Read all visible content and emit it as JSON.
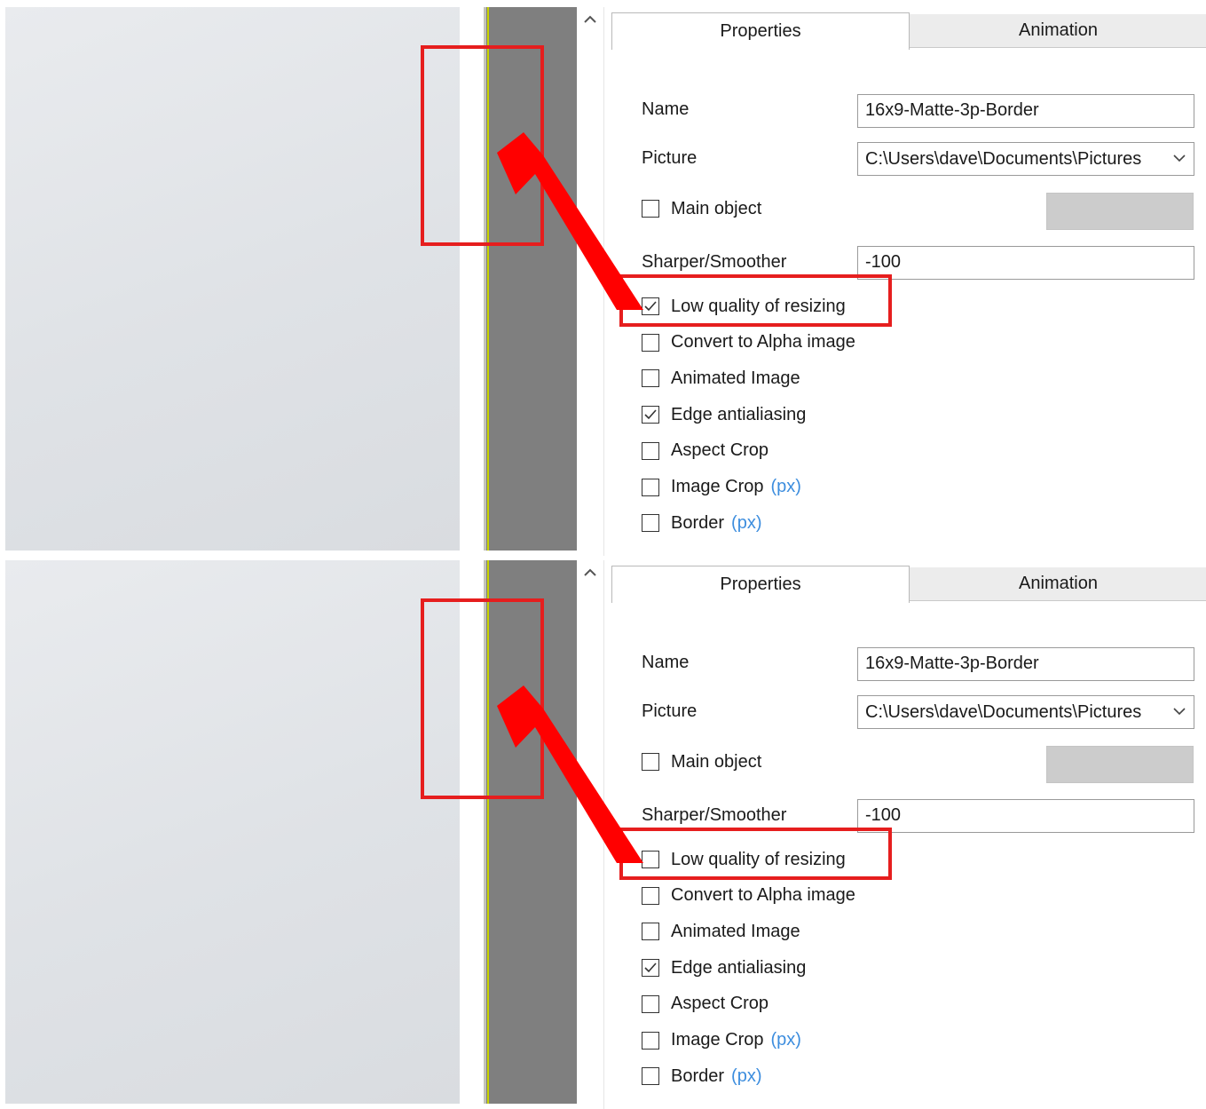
{
  "panels": [
    {
      "tabs": {
        "properties": "Properties",
        "animation": "Animation"
      },
      "name_label": "Name",
      "name_value": "16x9-Matte-3p-Border",
      "picture_label": "Picture",
      "picture_value": "C:\\Users\\dave\\Documents\\Pictures",
      "main_object_label": "Main object",
      "sharper_label": "Sharper/Smoother",
      "sharper_value": "-100",
      "checkboxes": [
        {
          "label": "Low quality of resizing",
          "checked": true
        },
        {
          "label": "Convert to Alpha image",
          "checked": false
        },
        {
          "label": "Animated Image",
          "checked": false
        },
        {
          "label": "Edge antialiasing",
          "checked": true
        },
        {
          "label": "Aspect Crop",
          "checked": false
        },
        {
          "label": "Image Crop",
          "unit": "(px)",
          "checked": false
        },
        {
          "label": "Border",
          "unit": "(px)",
          "checked": false
        }
      ]
    },
    {
      "tabs": {
        "properties": "Properties",
        "animation": "Animation"
      },
      "name_label": "Name",
      "name_value": "16x9-Matte-3p-Border",
      "picture_label": "Picture",
      "picture_value": "C:\\Users\\dave\\Documents\\Pictures",
      "main_object_label": "Main object",
      "sharper_label": "Sharper/Smoother",
      "sharper_value": "-100",
      "checkboxes": [
        {
          "label": "Low quality of resizing",
          "checked": false
        },
        {
          "label": "Convert to Alpha image",
          "checked": false
        },
        {
          "label": "Animated Image",
          "checked": false
        },
        {
          "label": "Edge antialiasing",
          "checked": true
        },
        {
          "label": "Aspect Crop",
          "checked": false
        },
        {
          "label": "Image Crop",
          "unit": "(px)",
          "checked": false
        },
        {
          "label": "Border",
          "unit": "(px)",
          "checked": false
        }
      ]
    }
  ],
  "colors": {
    "highlight": "#e61e1e",
    "unit_text": "#3c8dde",
    "guide_line": "#c9d400",
    "gray_strip": "#7f7f7f"
  },
  "icons": {
    "scroll": "chevron-up-icon",
    "dropdown": "chevron-down-icon",
    "check": "checkmark-icon",
    "annotation": "red-arrow-icon"
  }
}
